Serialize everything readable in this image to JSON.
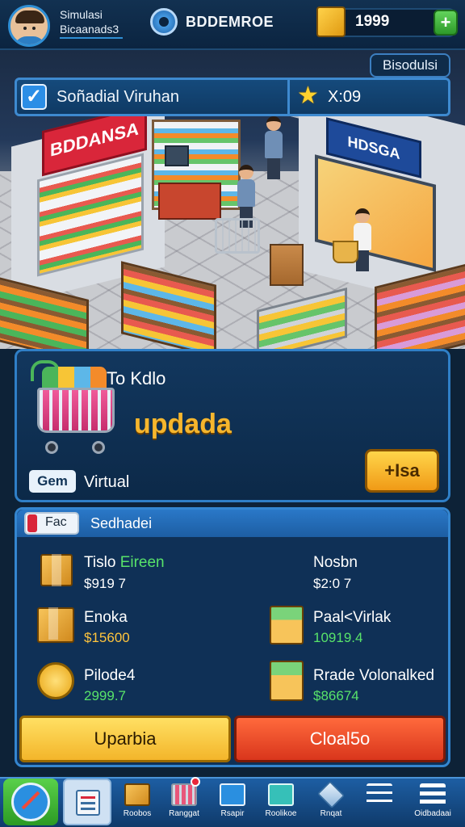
{
  "top_bar": {
    "player_name": "Simulasi",
    "player_sub": "Bicaanads3",
    "store_name": "BDDEMROE",
    "currency_value": "1999",
    "add_label": "+"
  },
  "scene": {
    "left_sign": "BDDANSA",
    "right_sign": "HDSGA",
    "top_sign": "BDDANSA",
    "corner_tab": "Bisodulsi"
  },
  "info_bar": {
    "checkbox_mark": "✓",
    "label": "Soñadial Viruhan",
    "star_value": "X:09"
  },
  "upgrade_card": {
    "title": "To Kdlo",
    "headline": "updada",
    "gem_tag": "Gem",
    "gem_label": "Virtual",
    "buy_label": "+Isa"
  },
  "stock_panel": {
    "tag": "Fac",
    "title": "Sedhadei",
    "items": [
      {
        "name": "Tislo",
        "name_extra": "Eireen",
        "value": "$919 7",
        "value_color": "white",
        "icon": "crate-icon"
      },
      {
        "name": "Nosbn",
        "name_extra": "",
        "value": "$2:0 7",
        "value_color": "white",
        "icon": "none"
      },
      {
        "name": "Enoka",
        "name_extra": "",
        "value": "$15600",
        "value_color": "gold",
        "icon": "crate-icon"
      },
      {
        "name": "Paal<Virlak",
        "name_extra": "",
        "value": "10919.4",
        "value_color": "green",
        "icon": "market-crate-icon"
      },
      {
        "name": "Pilode4",
        "name_extra": "",
        "value": "2999.7",
        "value_color": "green",
        "icon": "coin-icon"
      },
      {
        "name": "Rrade Volonalked",
        "name_extra": "",
        "value": "$86674",
        "value_color": "green",
        "icon": "market-crate-icon"
      }
    ],
    "update_button": "Uparbia",
    "close_button": "Cloal5o"
  },
  "bottom_nav": {
    "items": [
      {
        "label": "Roobos",
        "icon": "box-icon"
      },
      {
        "label": "Ranggat",
        "icon": "cart-icon"
      },
      {
        "label": "Rsapir",
        "icon": "phone-icon"
      },
      {
        "label": "Roolikoe",
        "icon": "screen-icon"
      },
      {
        "label": "Rnqat",
        "icon": "gem-icon"
      },
      {
        "label": "",
        "icon": "sliders-icon"
      },
      {
        "label": "Oidbadaai",
        "icon": "list-icon"
      }
    ]
  },
  "colors": {
    "accent_blue": "#2f7fc7",
    "gold": "#f5b62e",
    "green": "#58e36a",
    "red_button": "#d9361c"
  }
}
